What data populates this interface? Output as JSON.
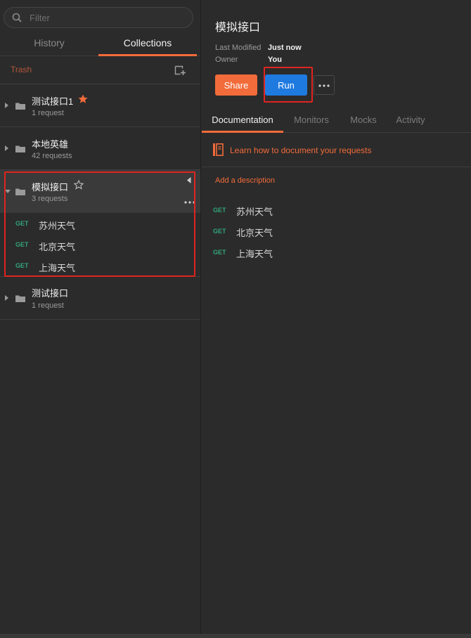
{
  "sidebar": {
    "search": {
      "placeholder": "Filter",
      "value": ""
    },
    "tabs": [
      {
        "label": "History",
        "active": false
      },
      {
        "label": "Collections",
        "active": true
      }
    ],
    "trash_label": "Trash",
    "collections": [
      {
        "name": "测试接口1",
        "count": "1 request",
        "starred": true,
        "expanded": false
      },
      {
        "name": "本地英雄",
        "count": "42 requests",
        "starred": false,
        "expanded": false
      },
      {
        "name": "模拟接口",
        "count": "3 requests",
        "starred": false,
        "expanded": true,
        "requests": [
          {
            "method": "GET",
            "name": "苏州天气"
          },
          {
            "method": "GET",
            "name": "北京天气"
          },
          {
            "method": "GET",
            "name": "上海天气"
          }
        ]
      },
      {
        "name": "测试接口",
        "count": "1 request",
        "starred": false,
        "expanded": false
      }
    ]
  },
  "main": {
    "title": "模拟接口",
    "meta": [
      {
        "key": "Last Modified",
        "value": "Just now"
      },
      {
        "key": "Owner",
        "value": "You"
      }
    ],
    "share_label": "Share",
    "run_label": "Run",
    "tabs": [
      {
        "label": "Documentation",
        "active": true
      },
      {
        "label": "Monitors",
        "active": false
      },
      {
        "label": "Mocks",
        "active": false
      },
      {
        "label": "Activity",
        "active": false
      }
    ],
    "learn_link": "Learn how to document your requests",
    "add_description": "Add a description",
    "requests": [
      {
        "method": "GET",
        "name": "苏州天气"
      },
      {
        "method": "GET",
        "name": "北京天气"
      },
      {
        "method": "GET",
        "name": "上海天气"
      }
    ]
  },
  "colors": {
    "accent": "#f26b3a",
    "run_button": "#1f7ae0",
    "get_method": "#31a37a",
    "highlight_box": "#e0241f",
    "background": "#2b2b2b"
  }
}
